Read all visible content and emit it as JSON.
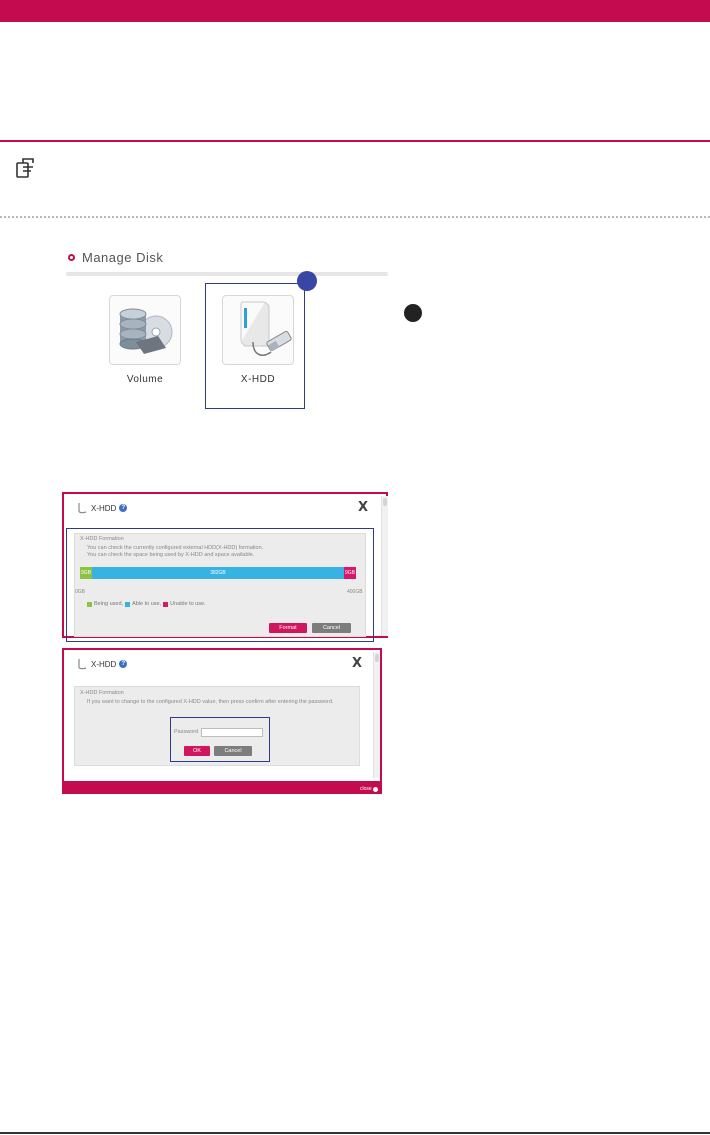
{
  "manage_disk": {
    "title": "Manage Disk",
    "tiles": [
      {
        "label": "Volume",
        "icon": "volume-icon"
      },
      {
        "label": "X-HDD",
        "icon": "xhdd-icon"
      }
    ]
  },
  "dialog1": {
    "title": "X-HDD",
    "close": "X",
    "section_title": "X-HDD Formation",
    "desc_line1": "You can check the currently configured external HDD(X-HDD) formation.",
    "desc_line2": "You can check the space being used by X-HDD and space available.",
    "bar": {
      "used_label": "9GB",
      "available_label": "382GB",
      "unable_label": "9GB",
      "used_gb": 9,
      "available_gb": 382,
      "unable_gb": 9
    },
    "axis_min": "0GB",
    "axis_max": "400GB",
    "legend": [
      "Being used,",
      "Able to use,",
      "Unable to use."
    ],
    "format_button": "Format",
    "cancel_button": "Cancel"
  },
  "dialog2": {
    "title": "X-HDD",
    "close": "X",
    "section_title": "X-HDD Formation",
    "desc": "If you want to change to the configured X-HDD value, then press confirm after entering the password.",
    "password_label": "Password",
    "ok_button": "OK",
    "cancel_button": "Cancel",
    "footer_close": "close"
  },
  "colors": {
    "brand": "#c40b4f",
    "used": "#8bc442",
    "available": "#37b3e3",
    "unable": "#d7186a",
    "highlight": "#2e3a8c"
  }
}
